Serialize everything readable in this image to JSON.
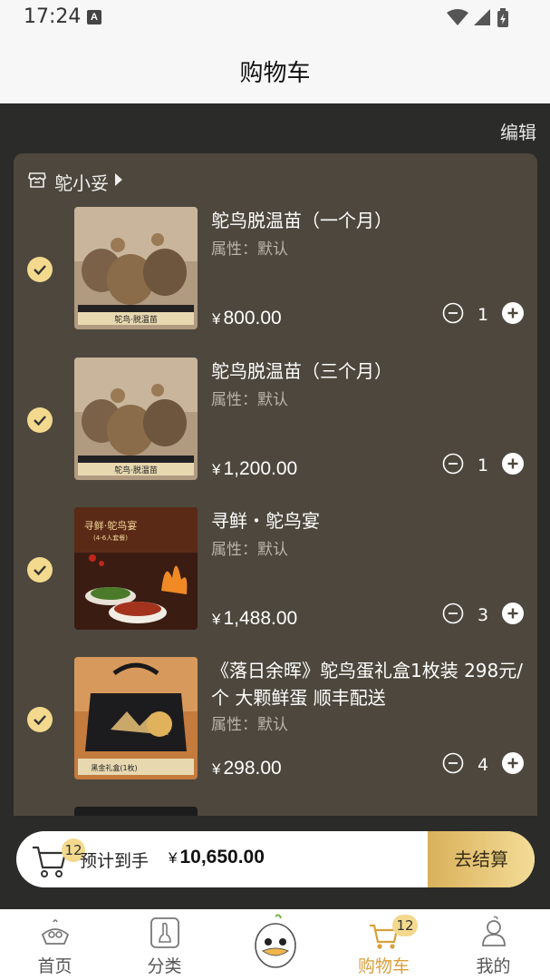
{
  "status_bar": {
    "time": "17:24",
    "notification_letter": "A"
  },
  "header": {
    "title": "购物车"
  },
  "edit_label": "编辑",
  "store": {
    "name": "鸵小妥"
  },
  "colors": {
    "accent_gold": "#f3d98e",
    "card_bg": "#4d473d",
    "active_tab": "#d8a03c"
  },
  "items": [
    {
      "title": "鸵鸟脱温苗（一个月）",
      "attr": "属性：默认",
      "yen": "¥",
      "price": "800.00",
      "qty": "1",
      "thumb_caption": "鸵鸟·脱温苗"
    },
    {
      "title": "鸵鸟脱温苗（三个月）",
      "attr": "属性：默认",
      "yen": "¥",
      "price": "1,200.00",
      "qty": "1",
      "thumb_caption": "鸵鸟·脱温苗"
    },
    {
      "title": "寻鲜・鸵鸟宴",
      "attr": "属性：默认",
      "yen": "¥",
      "price": "1,488.00",
      "qty": "3",
      "thumb_caption": "寻鲜·鸵鸟宴",
      "thumb_sub": "(4-6人套餐)"
    },
    {
      "title": "《落日余晖》鸵鸟蛋礼盒1枚装 298元/个 大颗鲜蛋 顺丰配送",
      "attr": "属性：默认",
      "yen": "¥",
      "price": "298.00",
      "qty": "4",
      "thumb_caption": "黑金礼盒(1枚)"
    }
  ],
  "summary": {
    "cart_count": "12",
    "estimate_label": "预计到手",
    "yen": "¥",
    "total": "10,650.00",
    "checkout_label": "去结算"
  },
  "tabs": [
    {
      "label": "首页",
      "icon": "home-icon"
    },
    {
      "label": "分类",
      "icon": "category-icon"
    },
    {
      "label": "",
      "icon": "mascot-icon"
    },
    {
      "label": "购物车",
      "icon": "cart-icon",
      "badge": "12"
    },
    {
      "label": "我的",
      "icon": "profile-icon"
    }
  ]
}
